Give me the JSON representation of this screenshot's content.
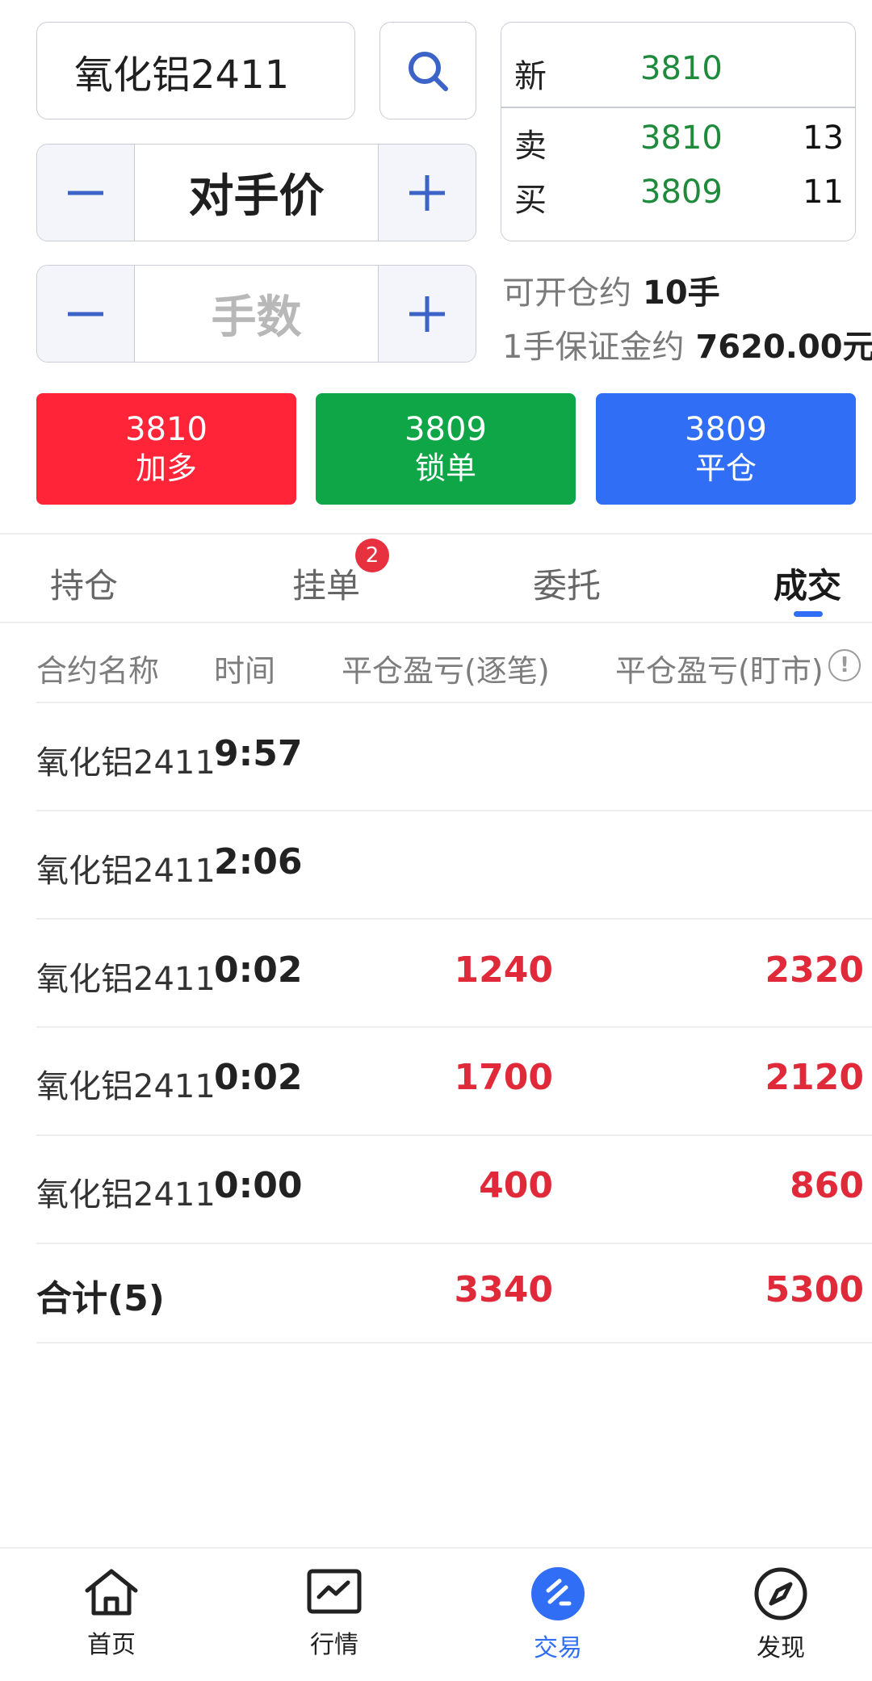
{
  "order": {
    "contract": "氧化铝2411",
    "price_mode": "对手价",
    "quantity_placeholder": "手数"
  },
  "quote": {
    "last_label": "新",
    "last_price": "3810",
    "ask_label": "卖",
    "ask_price": "3810",
    "ask_volume": "13",
    "bid_label": "买",
    "bid_price": "3809",
    "bid_volume": "11"
  },
  "account": {
    "can_open_label": "可开仓约",
    "can_open_value": "10手",
    "margin_label": "1手保证金约",
    "margin_value": "7620.00元"
  },
  "actions": [
    {
      "price": "3810",
      "label": "加多",
      "color": "#ff2438"
    },
    {
      "price": "3809",
      "label": "锁单",
      "color": "#0fa648"
    },
    {
      "price": "3809",
      "label": "平仓",
      "color": "#2f6ef5"
    }
  ],
  "tabs": [
    {
      "label": "持仓"
    },
    {
      "label": "挂单",
      "badge": "2"
    },
    {
      "label": "委托"
    },
    {
      "label": "成交",
      "active": true
    }
  ],
  "table": {
    "headers": [
      "合约名称",
      "时间",
      "平仓盈亏(逐笔)",
      "平仓盈亏(盯市)"
    ],
    "rows": [
      {
        "name": "氧化铝2411",
        "time": "9:57",
        "pnl_trade": "",
        "pnl_mark": ""
      },
      {
        "name": "氧化铝2411",
        "time": "2:06",
        "pnl_trade": "",
        "pnl_mark": ""
      },
      {
        "name": "氧化铝2411",
        "time": "0:02",
        "pnl_trade": "1240",
        "pnl_mark": "2320"
      },
      {
        "name": "氧化铝2411",
        "time": "0:02",
        "pnl_trade": "1700",
        "pnl_mark": "2120"
      },
      {
        "name": "氧化铝2411",
        "time": "0:00",
        "pnl_trade": "400",
        "pnl_mark": "860"
      }
    ],
    "total": {
      "label": "合计(5)",
      "pnl_trade": "3340",
      "pnl_mark": "5300"
    },
    "info_icon": "info-circle-icon"
  },
  "nav": [
    {
      "label": "首页",
      "icon": "home-icon"
    },
    {
      "label": "行情",
      "icon": "chart-icon"
    },
    {
      "label": "交易",
      "icon": "trade-icon",
      "active": true
    },
    {
      "label": "发现",
      "icon": "compass-icon"
    }
  ],
  "colors": {
    "accent": "#2f6ef5",
    "profit": "#e02a3a",
    "quote_green": "#1e8a3c"
  }
}
